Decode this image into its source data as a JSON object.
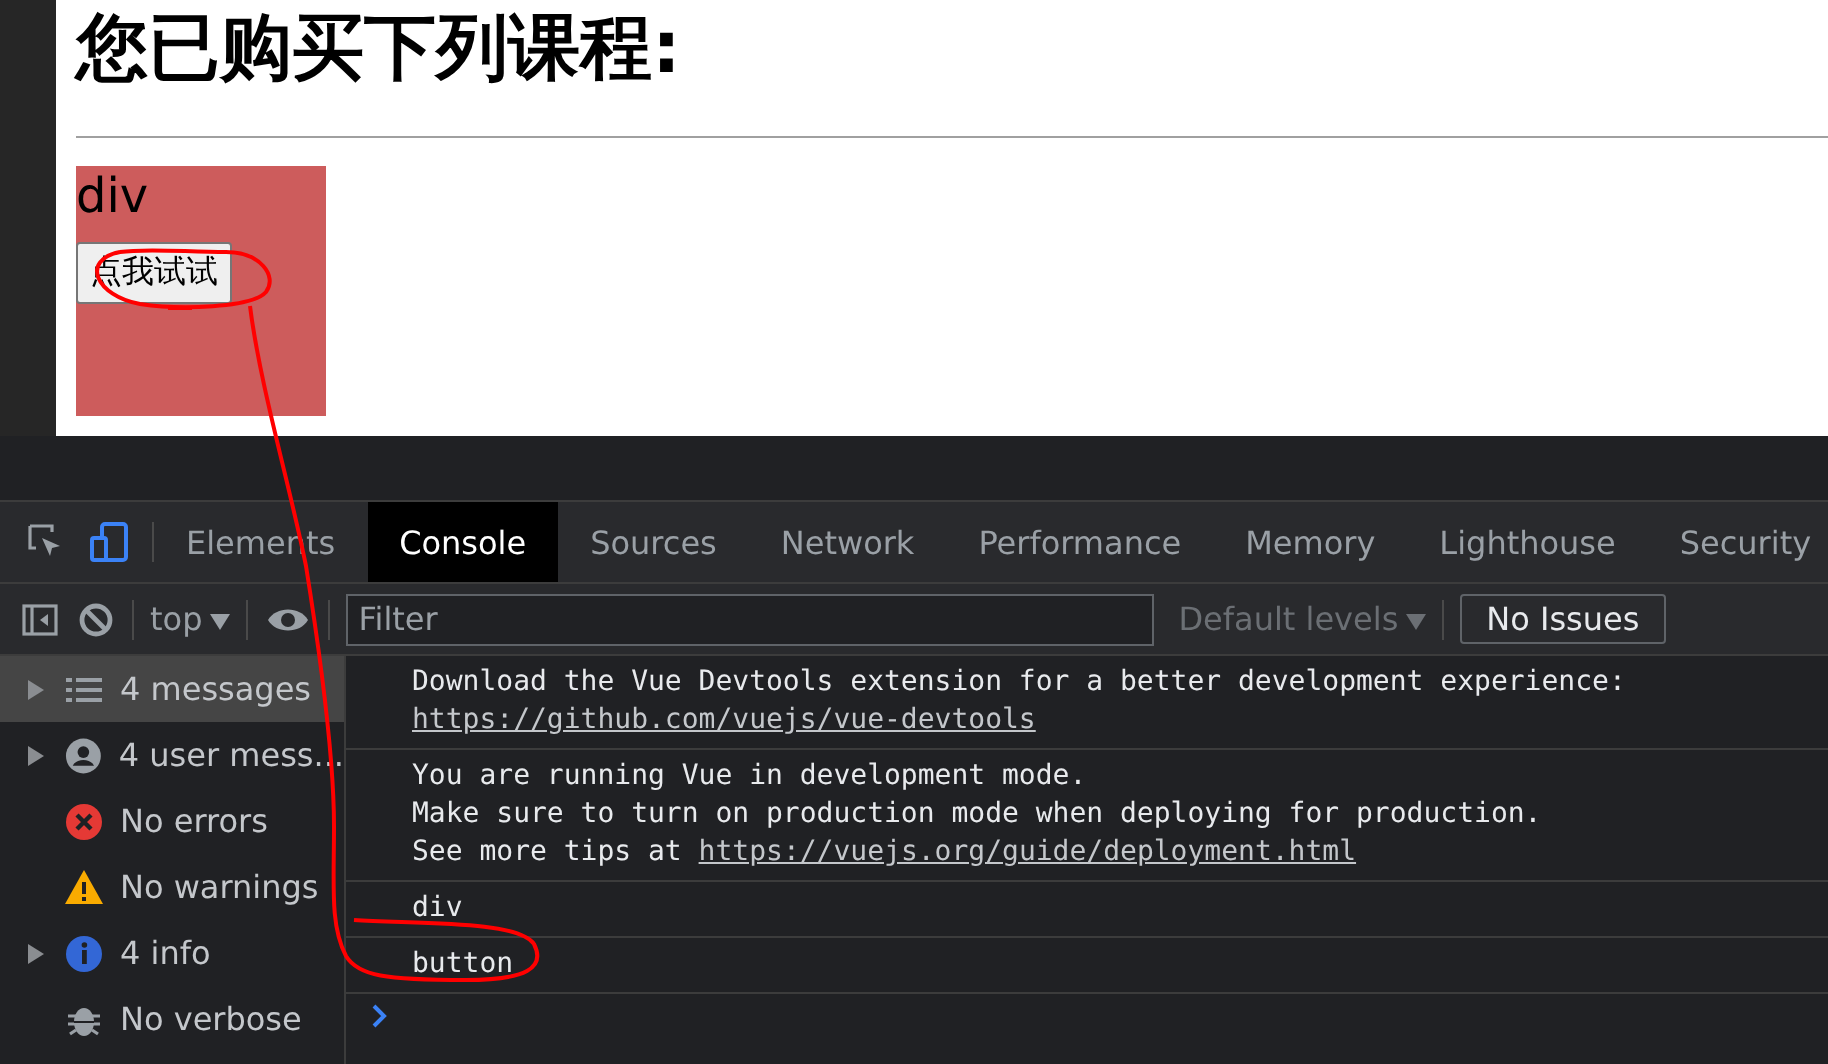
{
  "page": {
    "heading": "您已购买下列课程:",
    "box_label": "div",
    "button_label": "点我试试"
  },
  "devtools": {
    "tabs": [
      {
        "label": "Elements",
        "selected": false
      },
      {
        "label": "Console",
        "selected": true
      },
      {
        "label": "Sources",
        "selected": false
      },
      {
        "label": "Network",
        "selected": false
      },
      {
        "label": "Performance",
        "selected": false
      },
      {
        "label": "Memory",
        "selected": false
      },
      {
        "label": "Lighthouse",
        "selected": false
      },
      {
        "label": "Security",
        "selected": false
      }
    ],
    "toolbar": {
      "context": "top",
      "filter_placeholder": "Filter",
      "levels": "Default levels",
      "issues": "No Issues"
    },
    "sidebar": [
      {
        "kind": "messages",
        "label": "4 messages",
        "expandable": true,
        "selected": true
      },
      {
        "kind": "user",
        "label": "4 user mess...",
        "expandable": true,
        "selected": false
      },
      {
        "kind": "errors",
        "label": "No errors",
        "expandable": false,
        "selected": false
      },
      {
        "kind": "warnings",
        "label": "No warnings",
        "expandable": false,
        "selected": false
      },
      {
        "kind": "info",
        "label": "4 info",
        "expandable": true,
        "selected": false
      },
      {
        "kind": "verbose",
        "label": "No verbose",
        "expandable": false,
        "selected": false
      }
    ],
    "messages": [
      {
        "lines": [
          {
            "text": "Download the Vue Devtools extension for a better development experience:"
          },
          {
            "link": "https://github.com/vuejs/vue-devtools"
          }
        ]
      },
      {
        "lines": [
          {
            "text": "You are running Vue in development mode."
          },
          {
            "text": "Make sure to turn on production mode when deploying for production."
          },
          {
            "text": "See more tips at ",
            "link": "https://vuejs.org/guide/deployment.html"
          }
        ]
      },
      {
        "lines": [
          {
            "text": "div"
          }
        ]
      },
      {
        "lines": [
          {
            "text": "button"
          }
        ]
      }
    ]
  }
}
